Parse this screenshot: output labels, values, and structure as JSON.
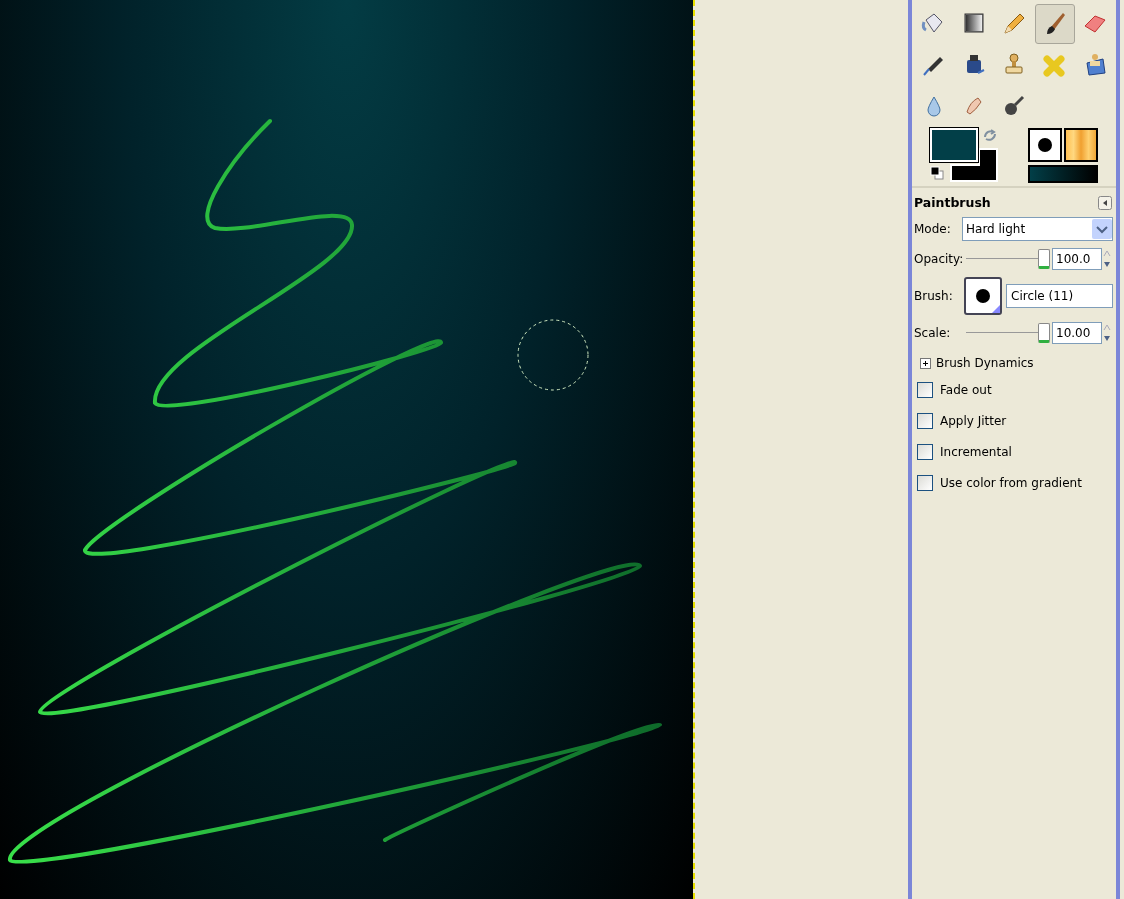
{
  "toolbox": {
    "tools": [
      {
        "kind": "bucket",
        "selected": false
      },
      {
        "kind": "gradient",
        "selected": false
      },
      {
        "kind": "pencil",
        "selected": false
      },
      {
        "kind": "paintbrush",
        "selected": true
      },
      {
        "kind": "eraser",
        "selected": false
      },
      {
        "kind": "airbrush",
        "selected": false
      },
      {
        "kind": "ink",
        "selected": false
      },
      {
        "kind": "clone",
        "selected": false
      },
      {
        "kind": "heal",
        "selected": false
      },
      {
        "kind": "perspective-clone",
        "selected": false
      },
      {
        "kind": "blur",
        "selected": false
      },
      {
        "kind": "smudge",
        "selected": false
      },
      {
        "kind": "dodge",
        "selected": false
      }
    ],
    "colors": [
      {
        "kind": "foreground",
        "color": "#023f48"
      },
      {
        "kind": "background",
        "color": "#000000"
      }
    ]
  },
  "tool_options": {
    "title": "Paintbrush",
    "mode": {
      "label": "Mode:",
      "value": "Hard light"
    },
    "opacity": {
      "label": "Opacity:",
      "level": 1.0,
      "value": "100.0"
    },
    "brush": {
      "label": "Brush:",
      "value": "Circle (11)"
    },
    "scale": {
      "label": "Scale:",
      "level": 1.0,
      "value": "10.00"
    },
    "dynamics": {
      "label": "Brush Dynamics",
      "expanded": false
    },
    "checkboxes": [
      {
        "label": "Fade out",
        "checked": false
      },
      {
        "label": "Apply Jitter",
        "checked": false
      },
      {
        "label": "Incremental",
        "checked": false
      },
      {
        "label": "Use color from gradient",
        "checked": false
      }
    ]
  }
}
